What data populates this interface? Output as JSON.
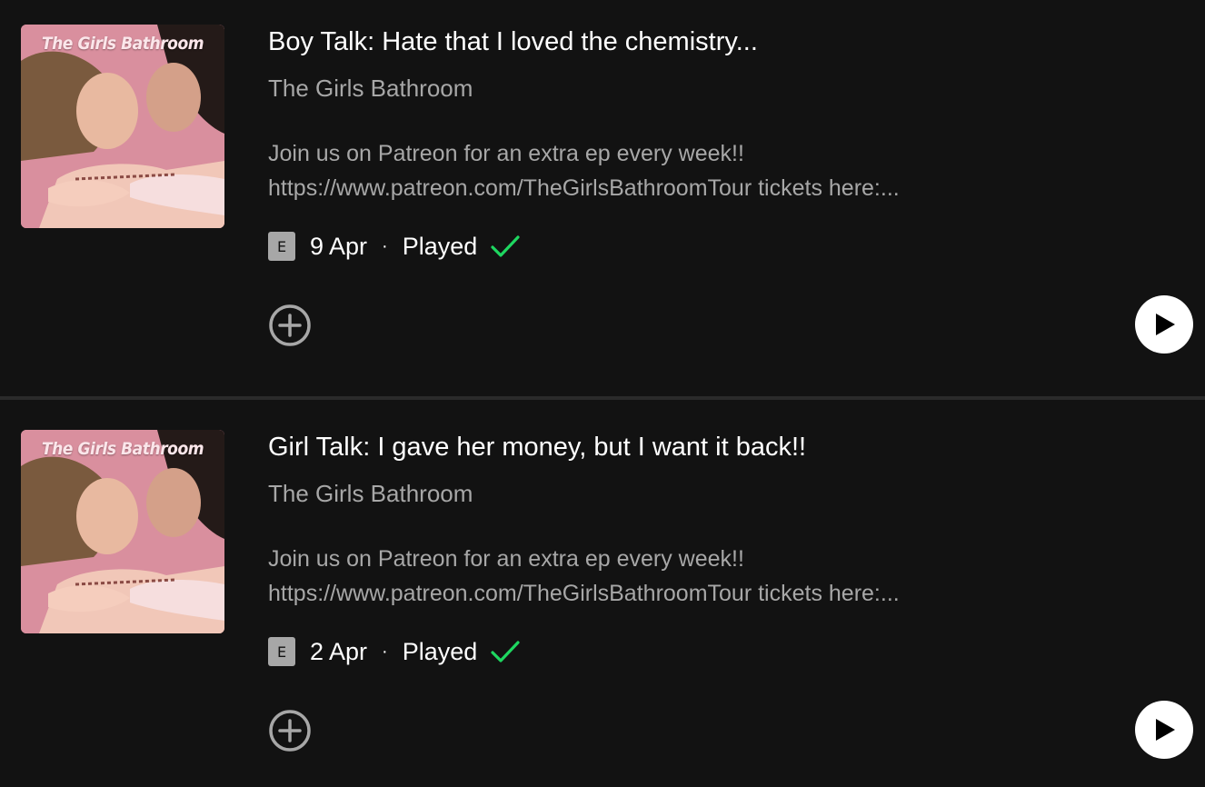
{
  "colors": {
    "background": "#121212",
    "divider": "#2a2a2a",
    "primary_text": "#ffffff",
    "secondary_text": "#a7a7a7",
    "played_check": "#1ed760",
    "cover_pink": "#d98f9e"
  },
  "episodes": [
    {
      "cover_text": "The Girls Bathroom",
      "title": "Boy Talk: Hate that I loved the chemistry...",
      "show": "The Girls Bathroom",
      "description_line1": "Join us on Patreon for an extra ep every week!!",
      "description_line2": "https://www.patreon.com/TheGirlsBathroomTour tickets here:...",
      "explicit_badge": "E",
      "date": "9 Apr",
      "separator": "·",
      "status": "Played",
      "status_icon": "check-icon",
      "add_icon": "plus-circle-icon",
      "play_icon": "play-icon"
    },
    {
      "cover_text": "The Girls Bathroom",
      "title": "Girl Talk: I gave her money, but I want it back!!",
      "show": "The Girls Bathroom",
      "description_line1": "Join us on Patreon for an extra ep every week!!",
      "description_line2": "https://www.patreon.com/TheGirlsBathroomTour tickets here:...",
      "explicit_badge": "E",
      "date": "2 Apr",
      "separator": "·",
      "status": "Played",
      "status_icon": "check-icon",
      "add_icon": "plus-circle-icon",
      "play_icon": "play-icon"
    }
  ]
}
